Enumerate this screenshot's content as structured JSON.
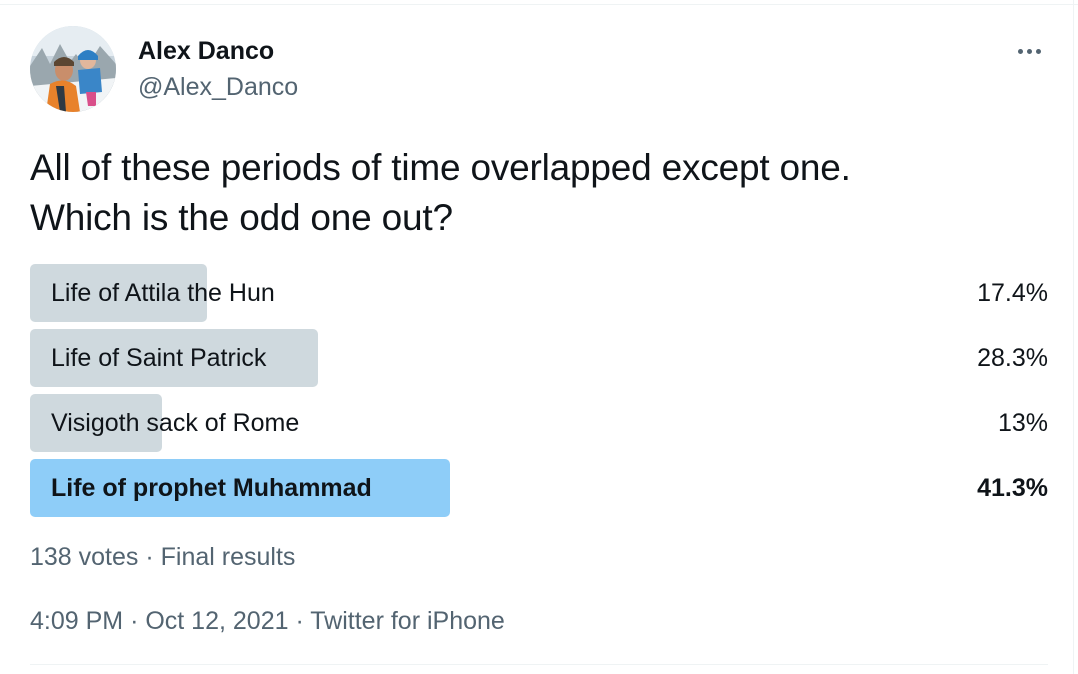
{
  "author": {
    "name": "Alex Danco",
    "handle": "@Alex_Danco"
  },
  "tweet": {
    "text_line1": "All of these periods of time overlapped except one.",
    "text_line2": "Which is the odd one out?"
  },
  "poll": {
    "options": [
      {
        "label": "Life of Attila the Hun",
        "percent_text": "17.4%",
        "percent": 17.4,
        "winner": false
      },
      {
        "label": "Life of Saint Patrick",
        "percent_text": "28.3%",
        "percent": 28.3,
        "winner": false
      },
      {
        "label": "Visigoth sack of Rome",
        "percent_text": "13%",
        "percent": 13,
        "winner": false
      },
      {
        "label": "Life of prophet Muhammad",
        "percent_text": "41.3%",
        "percent": 41.3,
        "winner": true
      }
    ],
    "votes": "138 votes",
    "separator": "·",
    "status": "Final results"
  },
  "meta": {
    "time": "4:09 PM",
    "date": "Oct 12, 2021",
    "source": "Twitter for iPhone",
    "separator": "·"
  },
  "colors": {
    "bar": "#cfd9de",
    "winner_bar": "#8ecdf8",
    "secondary_text": "#536471"
  },
  "icons": {
    "more": "more-horizontal-icon"
  }
}
